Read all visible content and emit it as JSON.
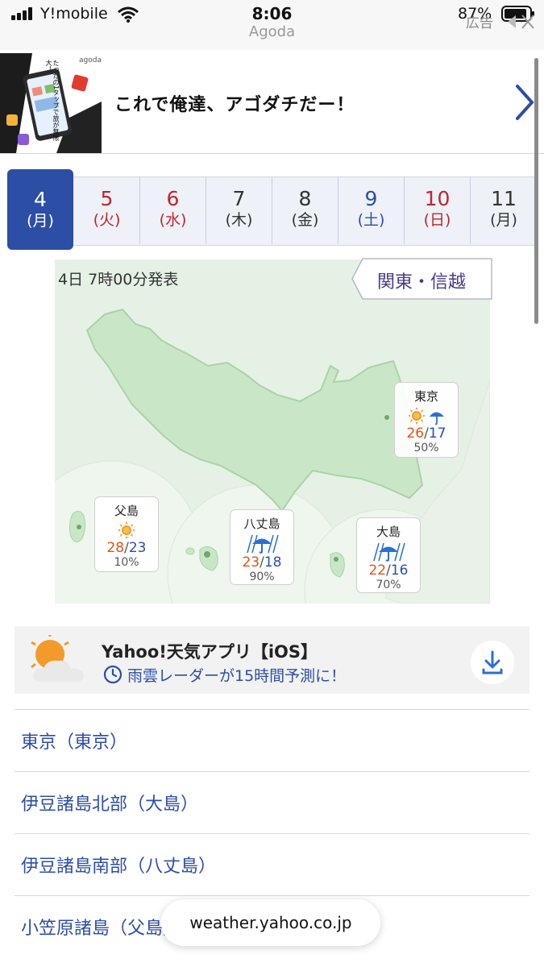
{
  "status_bar": {
    "carrier": "Y!mobile",
    "time": "8:06",
    "site": "Agoda",
    "battery": "87%"
  },
  "ad": {
    "headline": "これで俺達、アゴダチだー！",
    "label": "広告",
    "thumb_brand": "agoda",
    "thumb_caption": "たったの1タップで旅が無限大！"
  },
  "dates": [
    {
      "day": "4",
      "dow": "(月)",
      "color": "#ffffff",
      "selected": true
    },
    {
      "day": "5",
      "dow": "(火)",
      "color": "#c0262d"
    },
    {
      "day": "6",
      "dow": "(水)",
      "color": "#c0262d"
    },
    {
      "day": "7",
      "dow": "(木)",
      "color": "#333333"
    },
    {
      "day": "8",
      "dow": "(金)",
      "color": "#333333"
    },
    {
      "day": "9",
      "dow": "(土)",
      "color": "#2c4ea5"
    },
    {
      "day": "10",
      "dow": "(日)",
      "color": "#c0262d"
    },
    {
      "day": "11",
      "dow": "(月)",
      "color": "#333333"
    }
  ],
  "map": {
    "issued": "4日 7時00分発表",
    "region": "関東・信越",
    "cities": [
      {
        "name": "東京",
        "high": "26",
        "low": "17",
        "pop": "50%",
        "icon": "sun-umbrella-icon"
      },
      {
        "name": "父島",
        "high": "28",
        "low": "23",
        "pop": "10%",
        "icon": "sun-icon"
      },
      {
        "name": "八丈島",
        "high": "23",
        "low": "18",
        "pop": "90%",
        "icon": "rain-umbrella-icon"
      },
      {
        "name": "大島",
        "high": "22",
        "low": "16",
        "pop": "70%",
        "icon": "rain-umbrella-icon"
      }
    ],
    "separator": "/"
  },
  "app_banner": {
    "title": "Yahoo!天気アプリ【iOS】",
    "subtitle": "雨雲レーダーが15時間予測に！"
  },
  "areas": [
    "東京（東京）",
    "伊豆諸島北部（大島）",
    "伊豆諸島南部（八丈島）",
    "小笠原諸島（父島）"
  ],
  "browser": {
    "url": "weather.yahoo.co.jp"
  },
  "colors": {
    "accent": "#2c4ea5",
    "high_temp": "#e0541a",
    "map_land": "#c9e7c6"
  }
}
